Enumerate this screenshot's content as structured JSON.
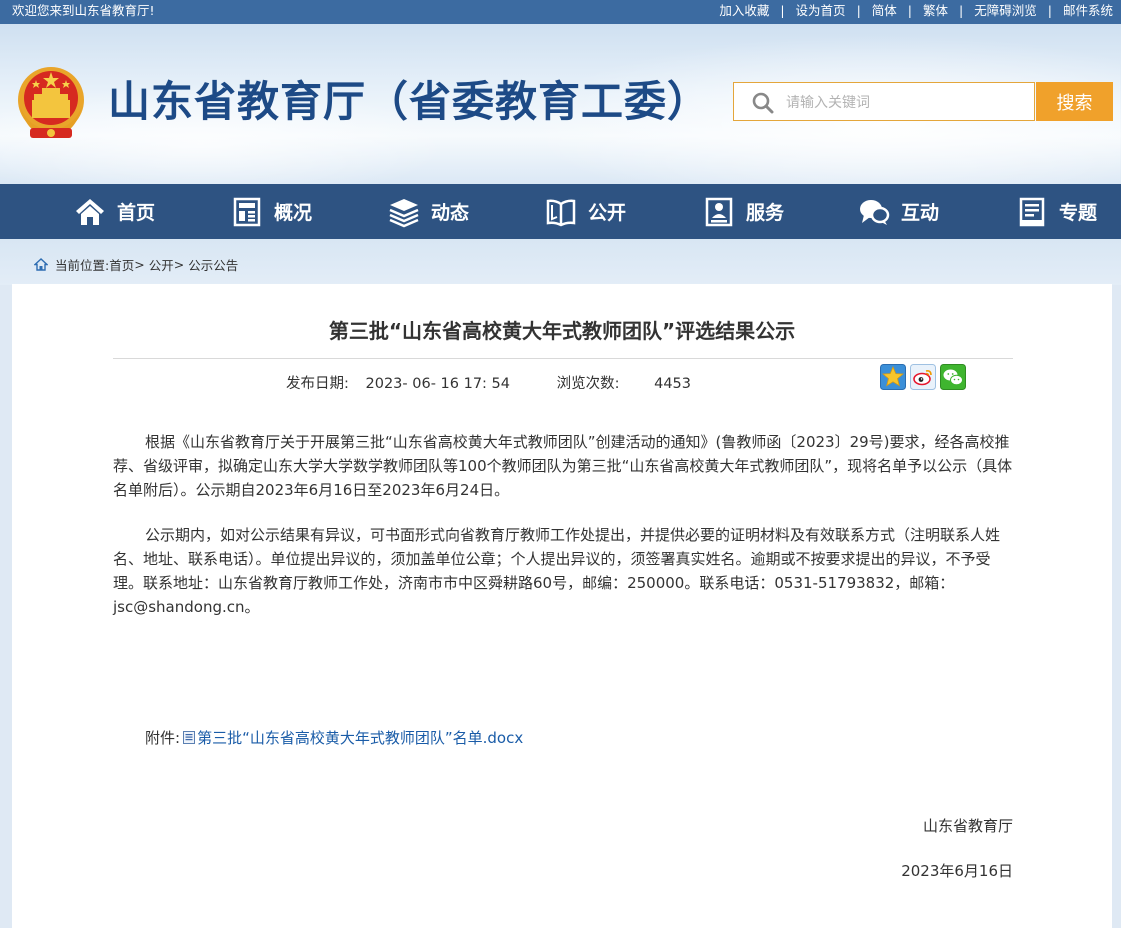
{
  "topbar": {
    "welcome": "欢迎您来到山东省教育厅!",
    "links": [
      "加入收藏",
      "设为首页",
      "简体",
      "繁体",
      "无障碍浏览",
      "邮件系统"
    ],
    "separator": "|"
  },
  "header": {
    "site_title": "山东省教育厅（省委教育工委）",
    "search_placeholder": "请输入关键词",
    "search_button": "搜索"
  },
  "nav": {
    "items": [
      {
        "label": "首页",
        "icon": "home-icon"
      },
      {
        "label": "概况",
        "icon": "overview-icon"
      },
      {
        "label": "动态",
        "icon": "news-stack-icon"
      },
      {
        "label": "公开",
        "icon": "open-book-icon"
      },
      {
        "label": "服务",
        "icon": "service-icon"
      },
      {
        "label": "互动",
        "icon": "chat-icon"
      },
      {
        "label": "专题",
        "icon": "topic-icon"
      }
    ]
  },
  "breadcrumb": {
    "prefix": "当前位置: ",
    "items": [
      "首页",
      "公开",
      "公示公告"
    ],
    "separator": ">"
  },
  "article": {
    "title": "第三批“山东省高校黄大年式教师团队”评选结果公示",
    "publish_label": "发布日期:",
    "publish_date": "2023- 06- 16 17: 54",
    "views_label": "浏览次数:",
    "views": "4453",
    "paragraphs": [
      "根据《山东省教育厅关于开展第三批“山东省高校黄大年式教师团队”创建活动的通知》(鲁教师函〔2023〕29号)要求，经各高校推荐、省级评审，拟确定山东大学大学数学教师团队等100个教师团队为第三批“山东省高校黄大年式教师团队”，现将名单予以公示（具体名单附后）。公示期自2023年6月16日至2023年6月24日。",
      "公示期内，如对公示结果有异议，可书面形式向省教育厅教师工作处提出，并提供必要的证明材料及有效联系方式（注明联系人姓名、地址、联系电话）。单位提出异议的，须加盖单位公章；个人提出异议的，须签署真实姓名。逾期或不按要求提出的异议，不予受理。联系地址：山东省教育厅教师工作处，济南市市中区舜耕路60号，邮编：250000。联系电话：0531-51793832，邮箱：jsc@shandong.cn。"
    ],
    "attachment_label": "附件:",
    "attachment_name": "第三批“山东省高校黄大年式教师团队”名单.docx",
    "signer": "山东省教育厅",
    "sign_date": "2023年6月16日"
  },
  "colors": {
    "topbar": "#3c6ba1",
    "nav": "#2e5382",
    "title_blue": "#1d4a86",
    "search_orange": "#f0a12b",
    "link_blue": "#1a5ca8"
  }
}
